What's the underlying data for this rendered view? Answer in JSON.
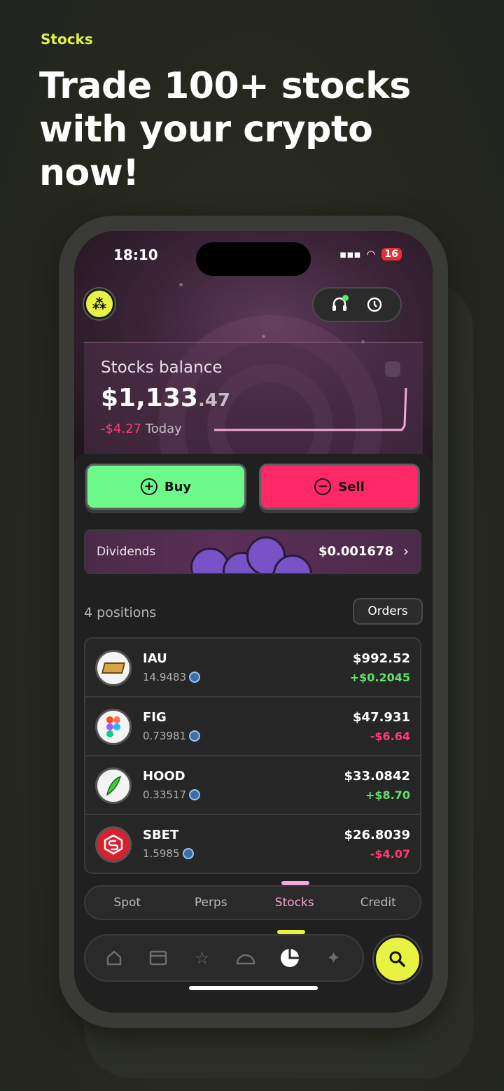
{
  "promo": {
    "eyebrow": "Stocks",
    "headline": "Trade 100+ stocks with your crypto now!"
  },
  "status_bar": {
    "time": "18:10",
    "battery": "16"
  },
  "balance": {
    "label": "Stocks balance",
    "amount_main": "$1,133",
    "amount_decimals": ".47",
    "change": "-$4.27",
    "change_period": "Today"
  },
  "actions": {
    "buy_label": "Buy",
    "sell_label": "Sell"
  },
  "dividends": {
    "label": "Dividends",
    "value": "$0.001678"
  },
  "positions": {
    "header": "4 positions",
    "orders_label": "Orders",
    "items": [
      {
        "ticker": "IAU",
        "quantity": "14.9483",
        "price": "$992.52",
        "change": "+$0.2045",
        "direction": "up",
        "icon": "gold-bar-icon"
      },
      {
        "ticker": "FIG",
        "quantity": "0.73981",
        "price": "$47.931",
        "change": "-$6.64",
        "direction": "down",
        "icon": "figma-logo-icon"
      },
      {
        "ticker": "HOOD",
        "quantity": "0.33517",
        "price": "$33.0842",
        "change": "+$8.70",
        "direction": "up",
        "icon": "feather-logo-icon"
      },
      {
        "ticker": "SBET",
        "quantity": "1.5985",
        "price": "$26.8039",
        "change": "-$4.07",
        "direction": "down",
        "icon": "sbet-logo-icon"
      }
    ]
  },
  "tabs": [
    {
      "label": "Spot",
      "active": false
    },
    {
      "label": "Perps",
      "active": false
    },
    {
      "label": "Stocks",
      "active": true
    },
    {
      "label": "Credit",
      "active": false
    }
  ],
  "nav": [
    {
      "icon": "home-icon",
      "active": false
    },
    {
      "icon": "store-icon",
      "active": false
    },
    {
      "icon": "star-icon",
      "active": false
    },
    {
      "icon": "gauge-icon",
      "active": false
    },
    {
      "icon": "pie-chart-icon",
      "active": true
    },
    {
      "icon": "sparkle-icon",
      "active": false
    }
  ],
  "colors": {
    "accent": "#e8f242",
    "buy": "#6cfb8a",
    "sell": "#ff2866",
    "positive": "#5ee36c",
    "negative": "#ff3b72",
    "active_tab": "#f2a8d8"
  }
}
